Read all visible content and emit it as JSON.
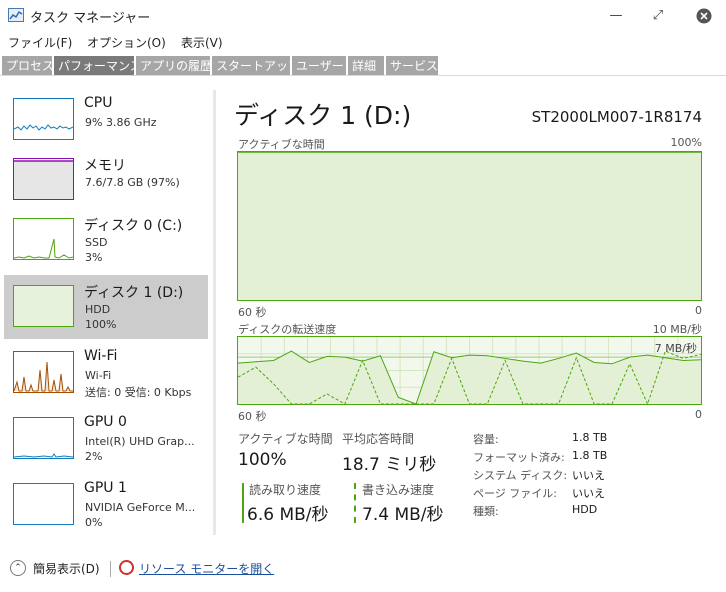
{
  "window": {
    "title": "タスク マネージャー"
  },
  "menu": [
    "ファイル(F)",
    "オプション(O)",
    "表示(V)"
  ],
  "tabs": [
    {
      "label": "プロセス",
      "active": false
    },
    {
      "label": "パフォーマンス",
      "active": true
    },
    {
      "label": "アプリの履歴",
      "active": false
    },
    {
      "label": "スタートアップ",
      "active": false
    },
    {
      "label": "ユーザー",
      "active": false
    },
    {
      "label": "詳細",
      "active": false
    },
    {
      "label": "サービス",
      "active": false
    }
  ],
  "sidebar": [
    {
      "name": "CPU",
      "lines": [
        "9%  3.86 GHz"
      ],
      "color": "#117dbb",
      "selected": false
    },
    {
      "name": "メモリ",
      "lines": [
        "7.6/7.8 GB (97%)"
      ],
      "color": "#8b12ae",
      "selected": false
    },
    {
      "name": "ディスク 0 (C:)",
      "lines": [
        "SSD",
        "3%"
      ],
      "color": "#4da60c",
      "selected": false
    },
    {
      "name": "ディスク 1 (D:)",
      "lines": [
        "HDD",
        "100%"
      ],
      "color": "#4da60c",
      "selected": true
    },
    {
      "name": "Wi-Fi",
      "lines": [
        "Wi-Fi",
        "送信: 0  受信: 0 Kbps"
      ],
      "color": "#a74f01",
      "selected": false
    },
    {
      "name": "GPU 0",
      "lines": [
        "Intel(R) UHD Grap...",
        "2%"
      ],
      "color": "#117dbb",
      "selected": false
    },
    {
      "name": "GPU 1",
      "lines": [
        "NVIDIA GeForce M...",
        "0%"
      ],
      "color": "#117dbb",
      "selected": false
    }
  ],
  "main": {
    "title": "ディスク 1 (D:)",
    "model": "ST2000LM007-1R8174",
    "active_time_graph": {
      "label": "アクティブな時間",
      "max_label": "100%",
      "xmin_label": "60 秒",
      "xmax_label": "0"
    },
    "transfer_graph": {
      "label": "ディスクの転送速度",
      "max_label": "10 MB/秒",
      "line_label": "7 MB/秒",
      "xmin_label": "60 秒",
      "xmax_label": "0"
    },
    "stats": {
      "active_time_label": "アクティブな時間",
      "active_time_value": "100%",
      "avg_response_label": "平均応答時間",
      "avg_response_value": "18.7 ミリ秒",
      "read_label": "読み取り速度",
      "read_value": "6.6 MB/秒",
      "write_label": "書き込み速度",
      "write_value": "7.4 MB/秒"
    },
    "properties": [
      {
        "key": "容量:",
        "value": "1.8 TB"
      },
      {
        "key": "フォーマット済み:",
        "value": "1.8 TB"
      },
      {
        "key": "システム ディスク:",
        "value": "いいえ"
      },
      {
        "key": "ページ ファイル:",
        "value": "いいえ"
      },
      {
        "key": "種類:",
        "value": "HDD"
      }
    ]
  },
  "footer": {
    "fewer_details": "簡易表示(D)",
    "resource_monitor": "リソース モニターを開く"
  },
  "chart_data": [
    {
      "type": "area",
      "title": "アクティブな時間",
      "x": [
        60,
        0
      ],
      "series": [
        {
          "values": [
            100,
            100
          ]
        }
      ],
      "ylim": [
        0,
        100
      ]
    },
    {
      "type": "line",
      "title": "ディスクの転送速度",
      "xlim": [
        60,
        0
      ],
      "ylim": [
        0,
        10
      ],
      "series": [
        {
          "name": "読み取り速度",
          "values": [
            6.1,
            6.3,
            6.5,
            7.9,
            6.2,
            7.1,
            7.0,
            6.4,
            7.2,
            1.0,
            0.0,
            7.8,
            6.9,
            7.3,
            7.2,
            6.8,
            6.4,
            6.1,
            6.8,
            7.6,
            6.2,
            6.0,
            7.0,
            7.3,
            6.9,
            6.5,
            6.6
          ]
        },
        {
          "name": "書き込み速度",
          "values": [
            4.0,
            5.5,
            3.0,
            0.0,
            0.0,
            1.5,
            0.0,
            6.5,
            0.0,
            0.0,
            0.0,
            0.0,
            6.8,
            0.0,
            0.0,
            6.5,
            0.0,
            0.0,
            0.0,
            6.9,
            0.0,
            0.0,
            6.0,
            0.0,
            7.9,
            6.8,
            7.4
          ]
        }
      ]
    }
  ]
}
